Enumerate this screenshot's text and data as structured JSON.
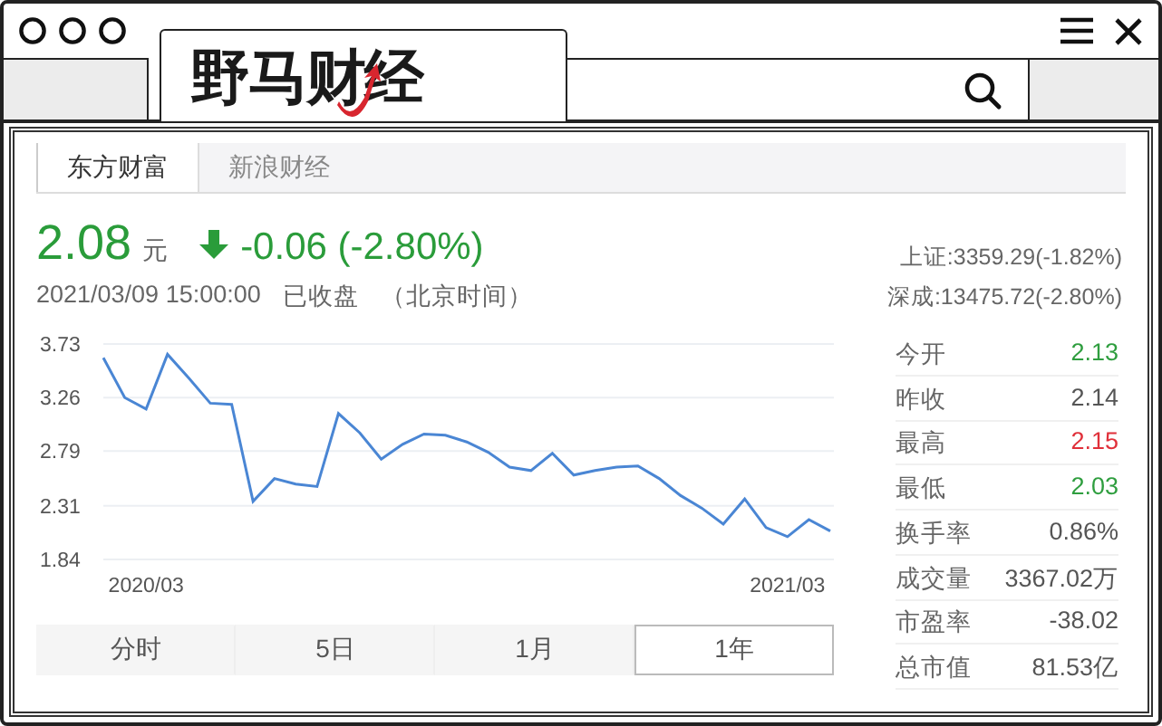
{
  "window": {
    "logo": "野马财经"
  },
  "source_tabs": [
    {
      "label": "东方财富",
      "selected": true
    },
    {
      "label": "新浪财经",
      "selected": false
    }
  ],
  "quote": {
    "price": "2.08",
    "unit": "元",
    "kind": "down",
    "change": "-0.06 (-2.80%)",
    "timestamp": "2021/03/09 15:00:00",
    "status": "已收盘",
    "timezone": "（北京时间）"
  },
  "indices": [
    "上证:3359.29(-1.82%)",
    "深成:13475.72(-2.80%)"
  ],
  "chart_data": {
    "type": "line",
    "grid": true,
    "ylim": [
      1.84,
      3.73
    ],
    "yticks": [
      3.73,
      3.26,
      2.79,
      2.31,
      1.84
    ],
    "categories": [
      null,
      null,
      "2020/03",
      null,
      null,
      null,
      null,
      null,
      null,
      null,
      null,
      null,
      null,
      null,
      null,
      null,
      null,
      null,
      null,
      null,
      null,
      null,
      null,
      null,
      null,
      null,
      null,
      null,
      null,
      null,
      null,
      null,
      "2021/03",
      null,
      null
    ],
    "series": [
      {
        "color": "#4a86d4",
        "values": [
          3.61,
          3.26,
          3.16,
          3.64,
          3.43,
          3.21,
          3.2,
          2.35,
          2.55,
          2.5,
          2.48,
          3.12,
          2.95,
          2.72,
          2.85,
          2.94,
          2.93,
          2.87,
          2.78,
          2.65,
          2.62,
          2.77,
          2.58,
          2.62,
          2.65,
          2.66,
          2.55,
          2.4,
          2.29,
          2.15,
          2.37,
          2.12,
          2.04,
          2.19,
          2.09
        ]
      }
    ]
  },
  "periods": [
    {
      "label": "分时",
      "selected": false
    },
    {
      "label": "5日",
      "selected": false
    },
    {
      "label": "1月",
      "selected": false
    },
    {
      "label": "1年",
      "selected": true
    }
  ],
  "stats": [
    {
      "label": "今开",
      "value": "2.13",
      "color": "#2f9e3f"
    },
    {
      "label": "昨收",
      "value": "2.14",
      "color": "#555555"
    },
    {
      "label": "最高",
      "value": "2.15",
      "color": "#e0303a"
    },
    {
      "label": "最低",
      "value": "2.03",
      "color": "#2f9e3f"
    },
    {
      "label": "换手率",
      "value": "0.86%",
      "color": "#555555"
    },
    {
      "label": "成交量",
      "value": "3367.02万",
      "color": "#555555"
    },
    {
      "label": "市盈率",
      "value": "-38.02",
      "color": "#555555"
    },
    {
      "label": "总市值",
      "value": "81.53亿",
      "color": "#555555"
    }
  ]
}
